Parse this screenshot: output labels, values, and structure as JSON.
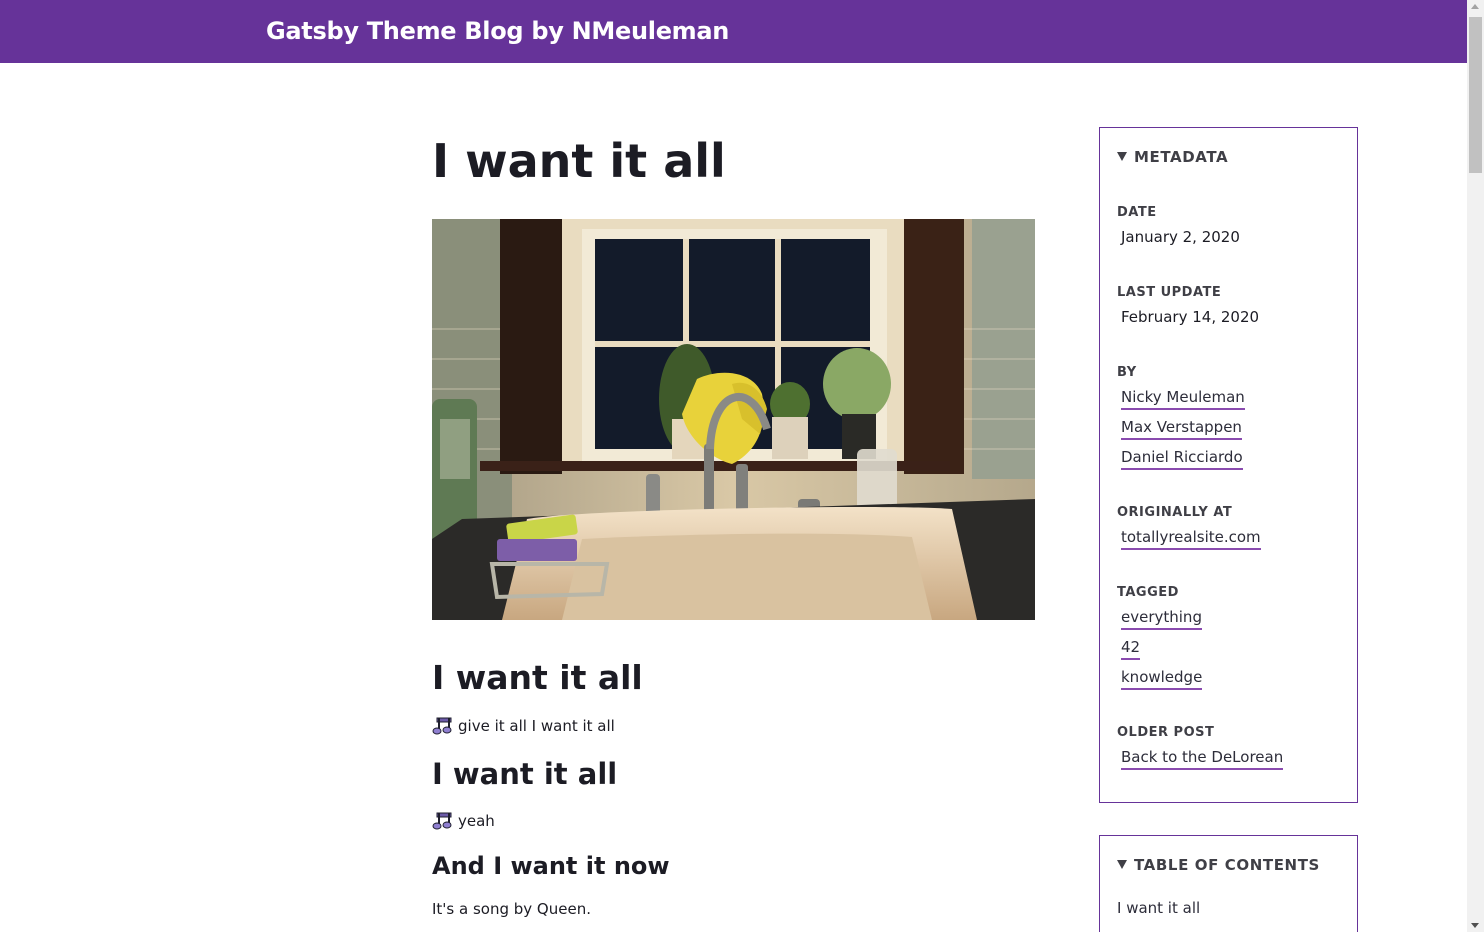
{
  "header": {
    "site_title": "Gatsby Theme Blog by NMeuleman"
  },
  "post": {
    "title": "I want it all",
    "sections": [
      {
        "heading": "I want it all",
        "text": "give it all I want it all"
      },
      {
        "heading": "I want it all",
        "text": "yeah"
      },
      {
        "heading": "And I want it now",
        "text": "It's a song by Queen."
      }
    ]
  },
  "metadata": {
    "heading": "METADATA",
    "date_label": "DATE",
    "date": "January 2, 2020",
    "last_update_label": "LAST UPDATE",
    "last_update": "February 14, 2020",
    "by_label": "BY",
    "authors": [
      "Nicky Meuleman",
      "Max Verstappen",
      "Daniel Ricciardo"
    ],
    "originally_at_label": "ORIGINALLY AT",
    "originally_at": "totallyrealsite.com",
    "tagged_label": "TAGGED",
    "tags": [
      "everything",
      "42",
      "knowledge"
    ],
    "older_post_label": "OLDER POST",
    "older_post": "Back to the DeLorean"
  },
  "toc": {
    "heading": "TABLE OF CONTENTS",
    "items": [
      "I want it all"
    ]
  },
  "colors": {
    "brand": "#663399",
    "link_underline": "#8a4baf"
  },
  "icons": {
    "music": "musical-notes-icon",
    "disclosure": "triangle-down-icon"
  }
}
